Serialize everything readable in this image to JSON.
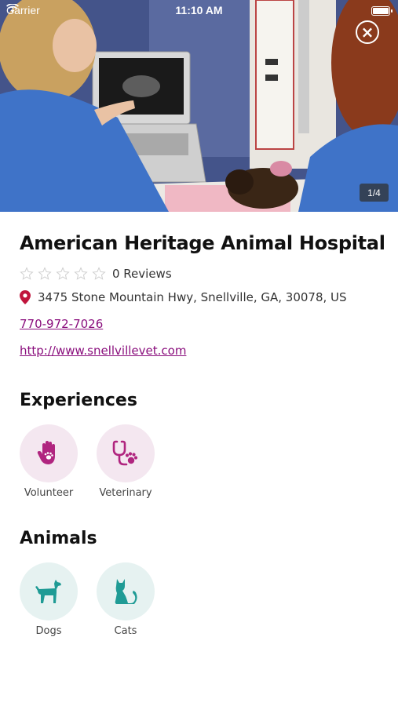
{
  "status_bar": {
    "carrier": "Carrier",
    "time": "11:10 AM"
  },
  "gallery": {
    "counter": "1/4"
  },
  "listing": {
    "name": "American Heritage Animal Hospital",
    "rating_stars": 0,
    "reviews": "0 Reviews",
    "address": "3475 Stone Mountain Hwy, Snellville, GA, 30078, US",
    "phone": "770-972-7026",
    "website": "http://www.snellvillevet.com"
  },
  "experiences": {
    "heading": "Experiences",
    "items": [
      {
        "label": "Volunteer",
        "icon": "hand-paw-icon"
      },
      {
        "label": "Veterinary",
        "icon": "stethoscope-paw-icon"
      }
    ]
  },
  "animals": {
    "heading": "Animals",
    "items": [
      {
        "label": "Dogs",
        "icon": "dog-icon"
      },
      {
        "label": "Cats",
        "icon": "cat-icon"
      }
    ]
  },
  "colors": {
    "accent": "#8a0f7d",
    "experience_icon": "#b0257f",
    "animal_icon": "#1f9b95",
    "pin": "#c0143c"
  }
}
